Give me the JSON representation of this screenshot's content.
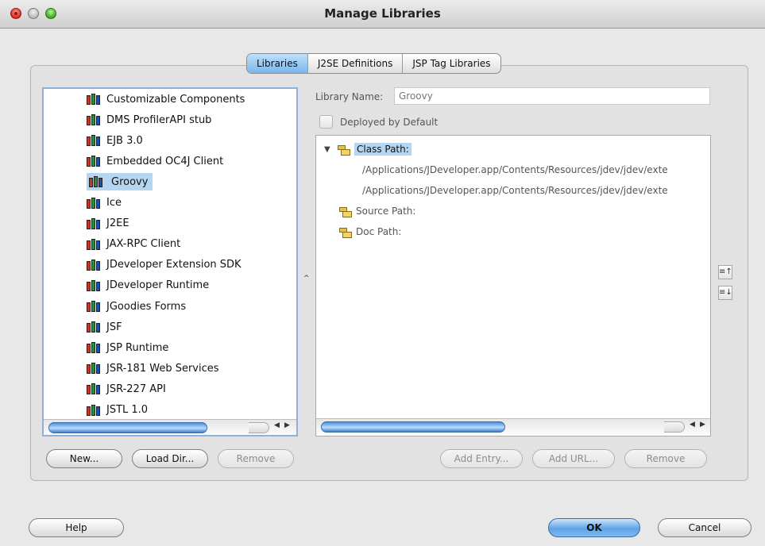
{
  "window": {
    "title": "Manage Libraries"
  },
  "tabs": [
    {
      "label": "Libraries",
      "active": true
    },
    {
      "label": "J2SE Definitions",
      "active": false
    },
    {
      "label": "JSP Tag Libraries",
      "active": false
    }
  ],
  "libraries": {
    "items": [
      "Customizable Components",
      "DMS ProfilerAPI stub",
      "EJB 3.0",
      "Embedded OC4J Client",
      "Groovy",
      "Ice",
      "J2EE",
      "JAX-RPC Client",
      "JDeveloper Extension SDK",
      "JDeveloper Runtime",
      "JGoodies Forms",
      "JSF",
      "JSP Runtime",
      "JSR-181 Web Services",
      "JSR-227 API",
      "JSTL 1.0"
    ],
    "selected_label": "Groovy",
    "icon": "library-books-icon",
    "buttons": {
      "new": "New...",
      "load_dir": "Load Dir...",
      "remove": "Remove"
    }
  },
  "details": {
    "library_name_label": "Library Name:",
    "library_name_value": "Groovy",
    "deployed_label": "Deployed by Default",
    "deployed_checked": false,
    "class_path_label": "Class Path:",
    "class_path_entries": [
      "/Applications/JDeveloper.app/Contents/Resources/jdev/jdev/exte",
      "/Applications/JDeveloper.app/Contents/Resources/jdev/jdev/exte"
    ],
    "source_path_label": "Source Path:",
    "doc_path_label": "Doc Path:",
    "buttons": {
      "add_entry": "Add Entry...",
      "add_url": "Add URL...",
      "remove": "Remove"
    }
  },
  "footer": {
    "help": "Help",
    "ok": "OK",
    "cancel": "Cancel"
  },
  "colors": {
    "selection": "#b6d5f1",
    "accent": "#5ea3e8",
    "close": "#d9261c",
    "zoom": "#3ea51e"
  }
}
